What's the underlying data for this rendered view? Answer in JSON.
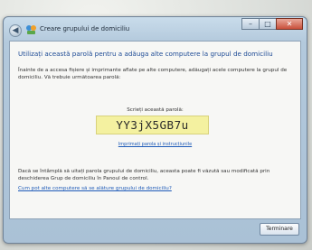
{
  "window": {
    "title": "Creare grupului de domiciliu",
    "controls": {
      "minimize_icon": "minimize-icon",
      "maximize_icon": "maximize-icon",
      "close_icon": "close-icon"
    }
  },
  "content": {
    "heading": "Utilizați această parolă pentru a adăuga alte computere la grupul de domiciliu",
    "intro": "Înainte de a accesa fișiere și imprimante aflate pe alte computere, adăugați acele computere la grupul de domiciliu. Vă trebuie următoarea parolă:",
    "password_label": "Scrieți această parolă:",
    "password": "YY3jX5GB7u",
    "print_link": "Imprimați parola și instrucțiunile",
    "note": "Dacă se întâmplă să uitați parola grupului de domiciliu, aceasta poate fi văzută sau modificată prin deschiderea Grup de domiciliu în Panoul de control.",
    "learn_link": "Cum pot alte computere să se alăture grupului de domiciliu?"
  },
  "footer": {
    "finish_label": "Terminare"
  },
  "colors": {
    "heading": "#1f4c96",
    "link": "#1f5bb8",
    "password_bg": "#f4f1a0"
  }
}
